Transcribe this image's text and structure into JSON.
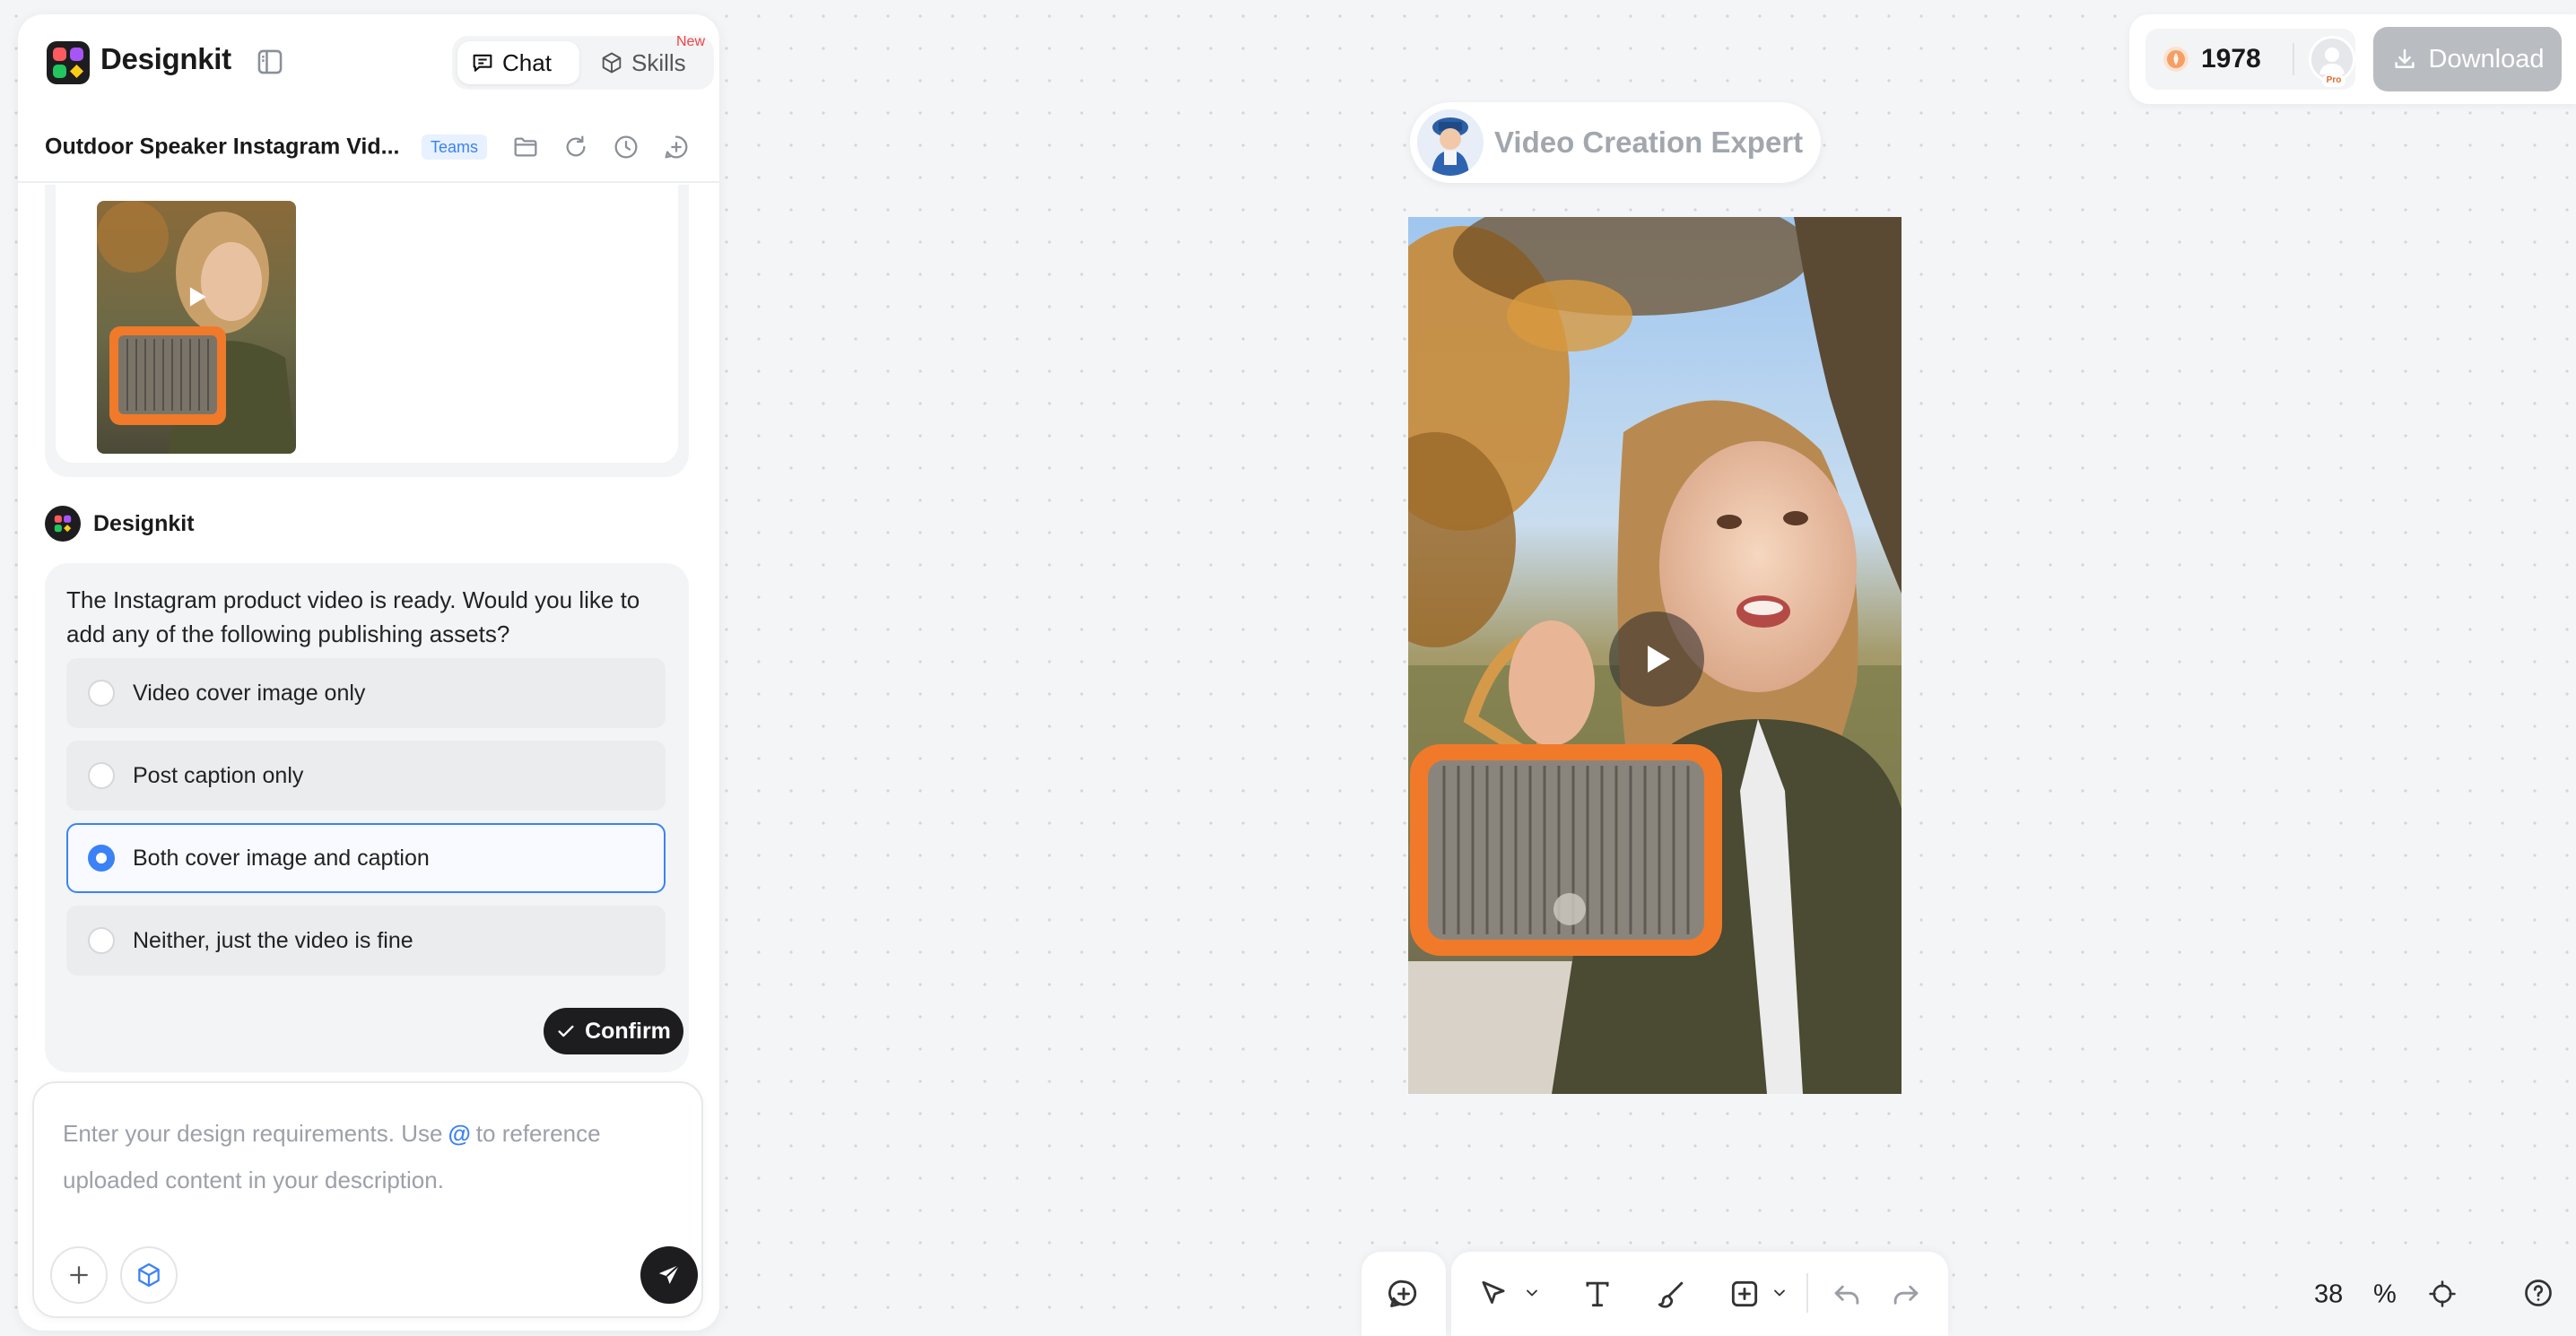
{
  "app": {
    "brand": "Designkit",
    "tabs": {
      "chat": "Chat",
      "skills": "Skills",
      "skills_badge": "New"
    }
  },
  "project": {
    "title": "Outdoor Speaker Instagram Vid...",
    "badge": "Teams"
  },
  "chat": {
    "bot_name": "Designkit",
    "answer": "The Instagram product video is ready. Would you like to add any of the following publishing assets?",
    "options": [
      {
        "label": "Video cover image only",
        "selected": false
      },
      {
        "label": "Post caption only",
        "selected": false
      },
      {
        "label": "Both cover image and caption",
        "selected": true
      },
      {
        "label": "Neither, just the video is fine",
        "selected": false
      }
    ],
    "confirm_label": "Confirm"
  },
  "composer": {
    "placeholder_before": "Enter your design requirements. Use",
    "placeholder_at": "@",
    "placeholder_after": "to reference uploaded content in your description."
  },
  "canvas": {
    "expert_name": "Video Creation Expert"
  },
  "account": {
    "credits": "1978",
    "plan_badge": "Pro",
    "download_label": "Download"
  },
  "zoom": {
    "value": "38",
    "unit": "%"
  },
  "colors": {
    "accent": "#3b82f6",
    "dark": "#1d1d1f",
    "disabled_button": "#b9bcc1",
    "badge_red": "#ef4444"
  },
  "icons": {
    "chat_tab": "chat-bubble-icon",
    "skills_tab": "cube-icon",
    "play": "play-icon",
    "send": "send-icon",
    "download": "download-icon",
    "help": "help-icon"
  }
}
